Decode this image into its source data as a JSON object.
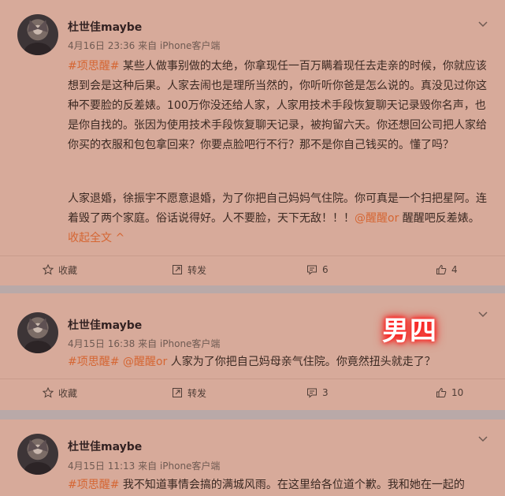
{
  "posts": [
    {
      "username": "杜世佳maybe",
      "meta": "4月16日 23:36 来自 iPhone客户端",
      "tag": "#项思醒#",
      "body_part1": " 某些人做事别做的太绝，你拿现任一百万瞒着现任去走亲的时候，你就应该想到会是这种后果。人家去闹也是理所当然的，你听听你爸是怎么说的。真没见过你这种不要脸的反差婊。100万你没还给人家，人家用技术手段恢复聊天记录毁你名声，也是你自找的。张因为使用技术手段恢复聊天记录，被拘留六天。你还想回公司把人家给你买的衣服和包包拿回来？你要点脸吧行不行？那不是你自己钱买的。懂了吗？",
      "body_part2": "人家退婚，徐振宇不愿意退婚，为了你把自己妈妈气住院。你可真是一个扫把星阿。连着毁了两个家庭。俗话说得好。人不要脸，天下无敌！！！",
      "mention": "@醒醒or",
      "body_part3": " 醒醒吧反差婊。",
      "collapse": "收起全文 ^",
      "actions": {
        "favorite": "收藏",
        "repost": "转发",
        "comment": "6",
        "like": "4"
      }
    },
    {
      "username": "杜世佳maybe",
      "meta": "4月15日 16:38 来自 iPhone客户端",
      "tag": "#项思醒#",
      "mention": "@醒醒or",
      "body": " 人家为了你把自己妈母亲气住院。你竟然扭头就走了？",
      "actions": {
        "favorite": "收藏",
        "repost": "转发",
        "comment": "3",
        "like": "10"
      }
    },
    {
      "username": "杜世佳maybe",
      "meta": "4月15日 11:13 来自 iPhone客户端",
      "tag": "#项思醒#",
      "body": " 我不知道事情会搞的满城风雨。在这里给各位道个歉。我和她在一起的"
    }
  ],
  "overlay_label": "男四",
  "icons": {
    "favorite": "star-icon",
    "repost": "repost-icon",
    "comment": "comment-icon",
    "like": "thumbs-up-icon",
    "menu": "chevron-down-icon"
  },
  "colors": {
    "background": "#d7aa9a",
    "separator": "#b9a9a8",
    "accent": "#d56633",
    "overlay_glow": "#ff0000"
  }
}
